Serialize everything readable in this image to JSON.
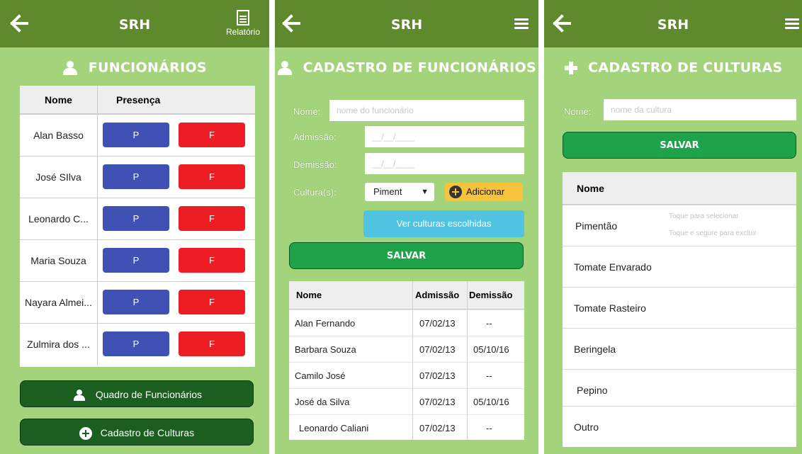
{
  "app_title": "SRH",
  "panel1": {
    "report_label": "Relatório",
    "heading": "FUNCIONÁRIOS",
    "table": {
      "col_name": "Nome",
      "col_presence": "Presença",
      "rows": [
        {
          "name": "Alan Basso",
          "p": "P",
          "f": "F"
        },
        {
          "name": "José SIlva",
          "p": "P",
          "f": "F"
        },
        {
          "name": "Leonardo C...",
          "p": "P",
          "f": "F"
        },
        {
          "name": "Maria Souza",
          "p": "P",
          "f": "F"
        },
        {
          "name": "Nayara Almei...",
          "p": "P",
          "f": "F"
        },
        {
          "name": "Zulmira dos ...",
          "p": "P",
          "f": "F"
        }
      ]
    },
    "btn_quadro": "Quadro de Funcionários",
    "btn_cadastro_culturas": "Cadastro de Culturas"
  },
  "panel2": {
    "heading": "CADASTRO DE FUNCIONÁRIOS",
    "nome_label": "Nome:",
    "nome_placeholder": "nome do funcionário",
    "admissao_label": "Admissão:",
    "admissao_placeholder": "__/__/____",
    "demissao_label": "Demissão:",
    "demissao_placeholder": "__/__/____",
    "cultura_label": "Cultura(s):",
    "cultura_selected": "Piment",
    "adicionar_label": "Adicionar",
    "ver_label": "Ver culturas escolhidas",
    "salvar_label": "SALVAR",
    "table": {
      "col_nome": "Nome",
      "col_admissao": "Admissão",
      "col_demissao": "Demissão",
      "rows": [
        {
          "nome": "Alan Fernando",
          "admissao": "07/02/13",
          "demissao": "--"
        },
        {
          "nome": "Barbara Souza",
          "admissao": "07/02/13",
          "demissao": "05/10/16"
        },
        {
          "nome": "Camilo José",
          "admissao": "07/02/13",
          "demissao": "--"
        },
        {
          "nome": "José da Silva",
          "admissao": "07/02/13",
          "demissao": "05/10/16"
        },
        {
          "nome": "Leonardo Caliani",
          "admissao": "07/02/13",
          "demissao": "--"
        }
      ]
    }
  },
  "panel3": {
    "heading": "CADASTRO DE CULTURAS",
    "nome_label": "Nome:",
    "nome_placeholder": "nome da cultura",
    "salvar_label": "SALVAR",
    "list_header": "Nome",
    "items": [
      "Pimentão",
      "Tomate Envarado",
      "Tomate Rasteiro",
      "Beringela",
      "Pepino",
      "Outro"
    ],
    "hint_select": "Toque para selecionar",
    "hint_delete": "Toque e segure para excluir"
  },
  "colors": {
    "topbar": "#5e8a2d",
    "panel_bg": "#a3d47c",
    "present": "#3f51b5",
    "absent": "#ec1e24",
    "save": "#1ea24a",
    "dark_button": "#1b5e20"
  }
}
